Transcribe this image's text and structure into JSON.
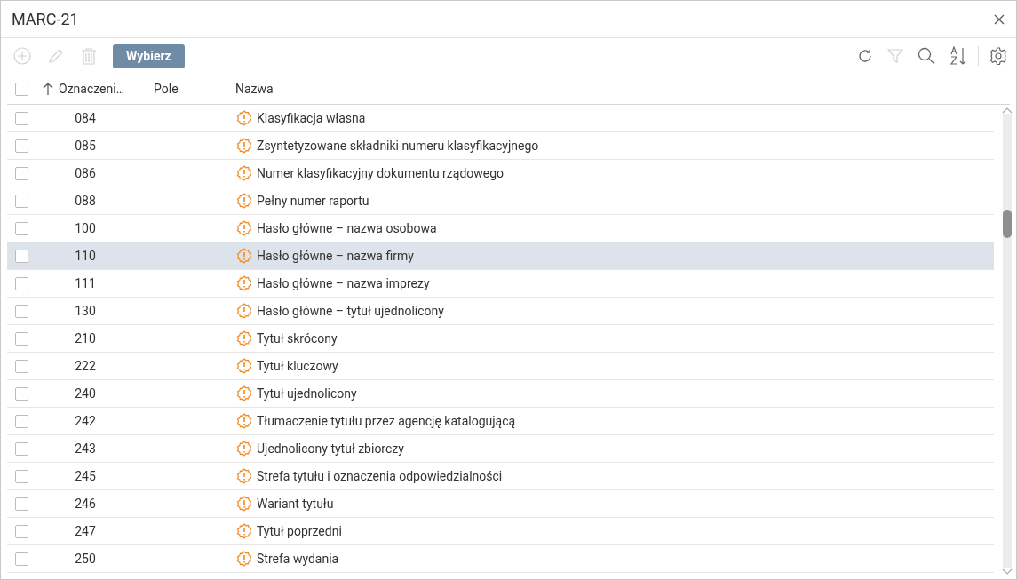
{
  "window": {
    "title": "MARC-21"
  },
  "toolbar": {
    "left_tools": [
      {
        "kind": "add",
        "disabled": true
      },
      {
        "kind": "edit",
        "disabled": true
      },
      {
        "kind": "delete",
        "disabled": true
      }
    ],
    "primary_button": "Wybierz",
    "right_tools": [
      {
        "kind": "refresh",
        "disabled": false
      },
      {
        "kind": "filter",
        "disabled": true
      },
      {
        "kind": "search",
        "disabled": false
      },
      {
        "kind": "sort",
        "disabled": false
      },
      {
        "kind": "settings",
        "disabled": false
      }
    ]
  },
  "table": {
    "select_all_checked": false,
    "sort_ascending": true,
    "columns": [
      "Oznaczeni…",
      "Pole",
      "Nazwa"
    ],
    "rows": [
      {
        "code": "084",
        "name": "Klasyfikacja własna",
        "checked": false,
        "selected": false
      },
      {
        "code": "085",
        "name": "Zsyntetyzowane składniki numeru klasyfikacyjnego",
        "checked": false,
        "selected": false
      },
      {
        "code": "086",
        "name": "Numer klasyfikacyjny dokumentu rządowego",
        "checked": false,
        "selected": false
      },
      {
        "code": "088",
        "name": "Pełny numer raportu",
        "checked": false,
        "selected": false
      },
      {
        "code": "100",
        "name": "Hasło główne – nazwa osobowa",
        "checked": false,
        "selected": false
      },
      {
        "code": "110",
        "name": "Hasło główne – nazwa firmy",
        "checked": false,
        "selected": true
      },
      {
        "code": "111",
        "name": "Hasło główne – nazwa imprezy",
        "checked": false,
        "selected": false
      },
      {
        "code": "130",
        "name": "Hasło główne – tytuł ujednolicony",
        "checked": false,
        "selected": false
      },
      {
        "code": "210",
        "name": "Tytuł skrócony",
        "checked": false,
        "selected": false
      },
      {
        "code": "222",
        "name": "Tytuł kluczowy",
        "checked": false,
        "selected": false
      },
      {
        "code": "240",
        "name": "Tytuł ujednolicony",
        "checked": false,
        "selected": false
      },
      {
        "code": "242",
        "name": "Tłumaczenie tytułu przez agencję katalogującą",
        "checked": false,
        "selected": false
      },
      {
        "code": "243",
        "name": "Ujednolicony tytuł zbiorczy",
        "checked": false,
        "selected": false
      },
      {
        "code": "245",
        "name": "Strefa tytułu i oznaczenia odpowiedzialności",
        "checked": false,
        "selected": false
      },
      {
        "code": "246",
        "name": "Wariant tytułu",
        "checked": false,
        "selected": false
      },
      {
        "code": "247",
        "name": "Tytuł poprzedni",
        "checked": false,
        "selected": false
      },
      {
        "code": "250",
        "name": "Strefa wydania",
        "checked": false,
        "selected": false
      }
    ]
  }
}
